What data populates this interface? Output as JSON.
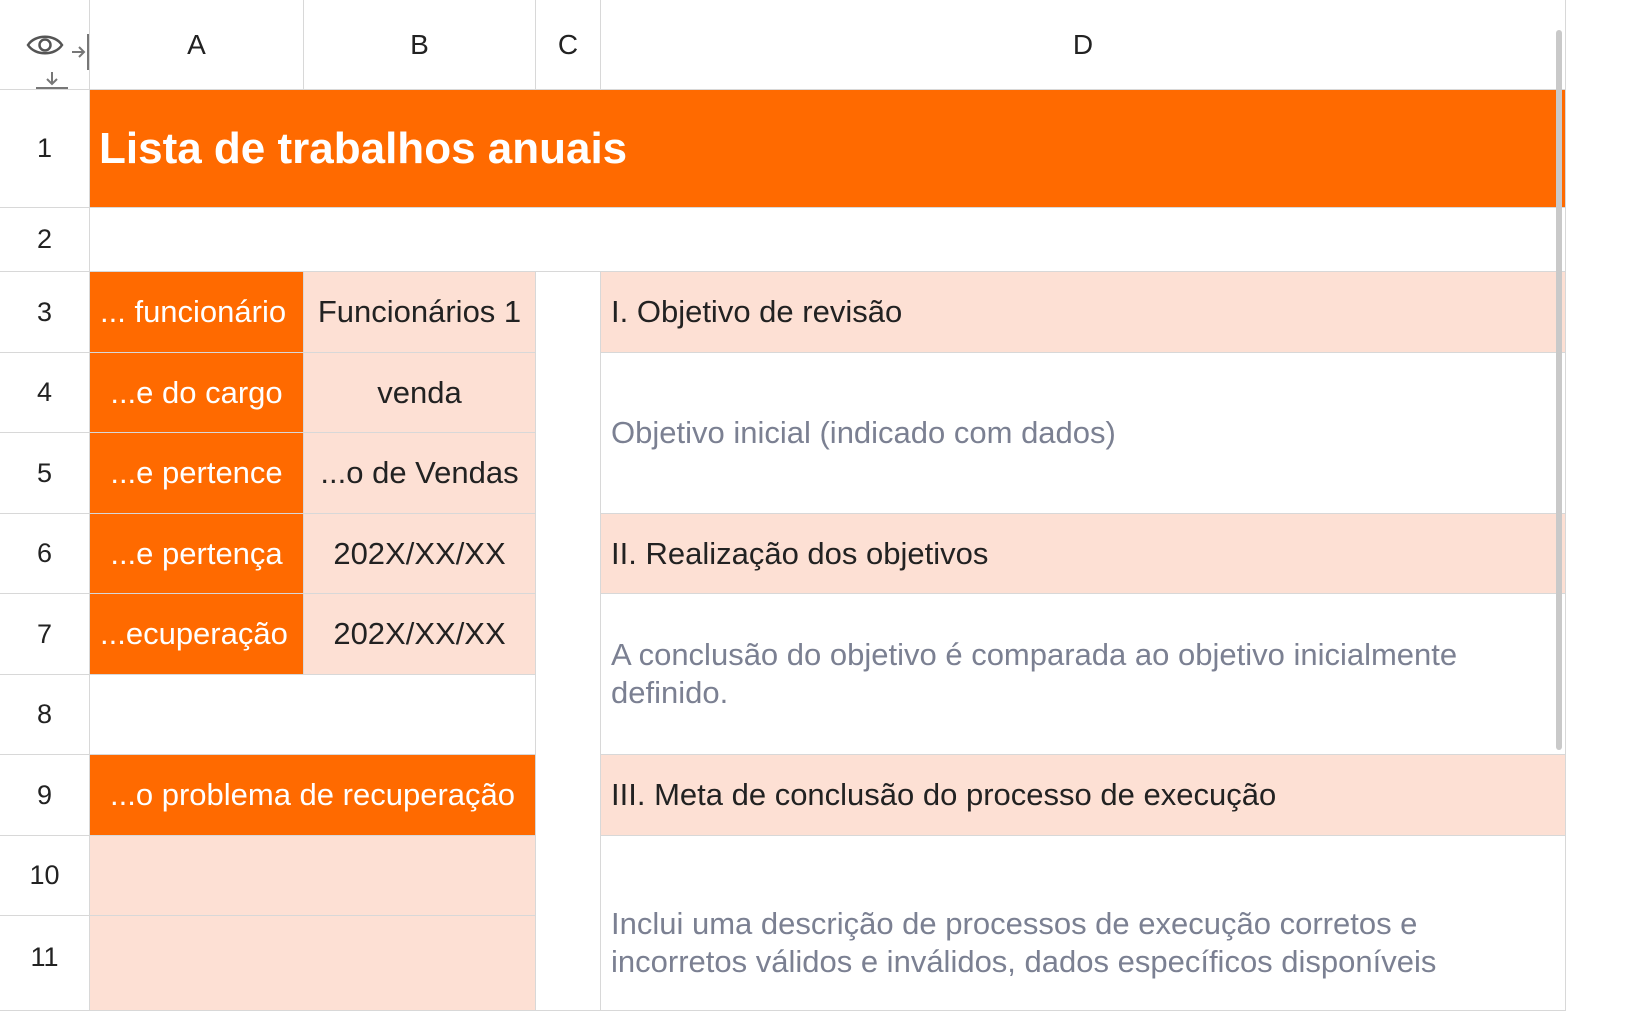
{
  "columns": [
    "A",
    "B",
    "C",
    "D"
  ],
  "rows": [
    "1",
    "2",
    "3",
    "4",
    "5",
    "6",
    "7",
    "8",
    "9",
    "10",
    "11"
  ],
  "icons": {
    "eye": "eye-icon",
    "collapse_cols": "collapse-columns-icon",
    "collapse_rows": "collapse-rows-icon"
  },
  "colors": {
    "accent": "#ff6a00",
    "peach": "#fde0d4",
    "muted_text": "#7b8092"
  },
  "sheet": {
    "title": "Lista de trabalhos anuais",
    "left_labels": [
      "... funcionário",
      "...e do cargo",
      "...e pertence",
      "...e pertença",
      "...ecuperação"
    ],
    "left_values": [
      "Funcionários 1",
      "venda",
      "...o de Vendas",
      "202X/XX/XX",
      "202X/XX/XX"
    ],
    "recovery_header": "...o problema de recuperação",
    "sections": [
      {
        "heading": "I. Objetivo de revisão",
        "body": "Objetivo inicial (indicado com dados)"
      },
      {
        "heading": "II. Realização dos objetivos",
        "body": "A conclusão do objetivo é comparada ao objetivo inicialmente definido."
      },
      {
        "heading": "III. Meta de conclusão do processo de execução",
        "body": "Inclui uma descrição de processos de execução corretos e incorretos válidos e inválidos, dados específicos disponíveis"
      }
    ]
  }
}
